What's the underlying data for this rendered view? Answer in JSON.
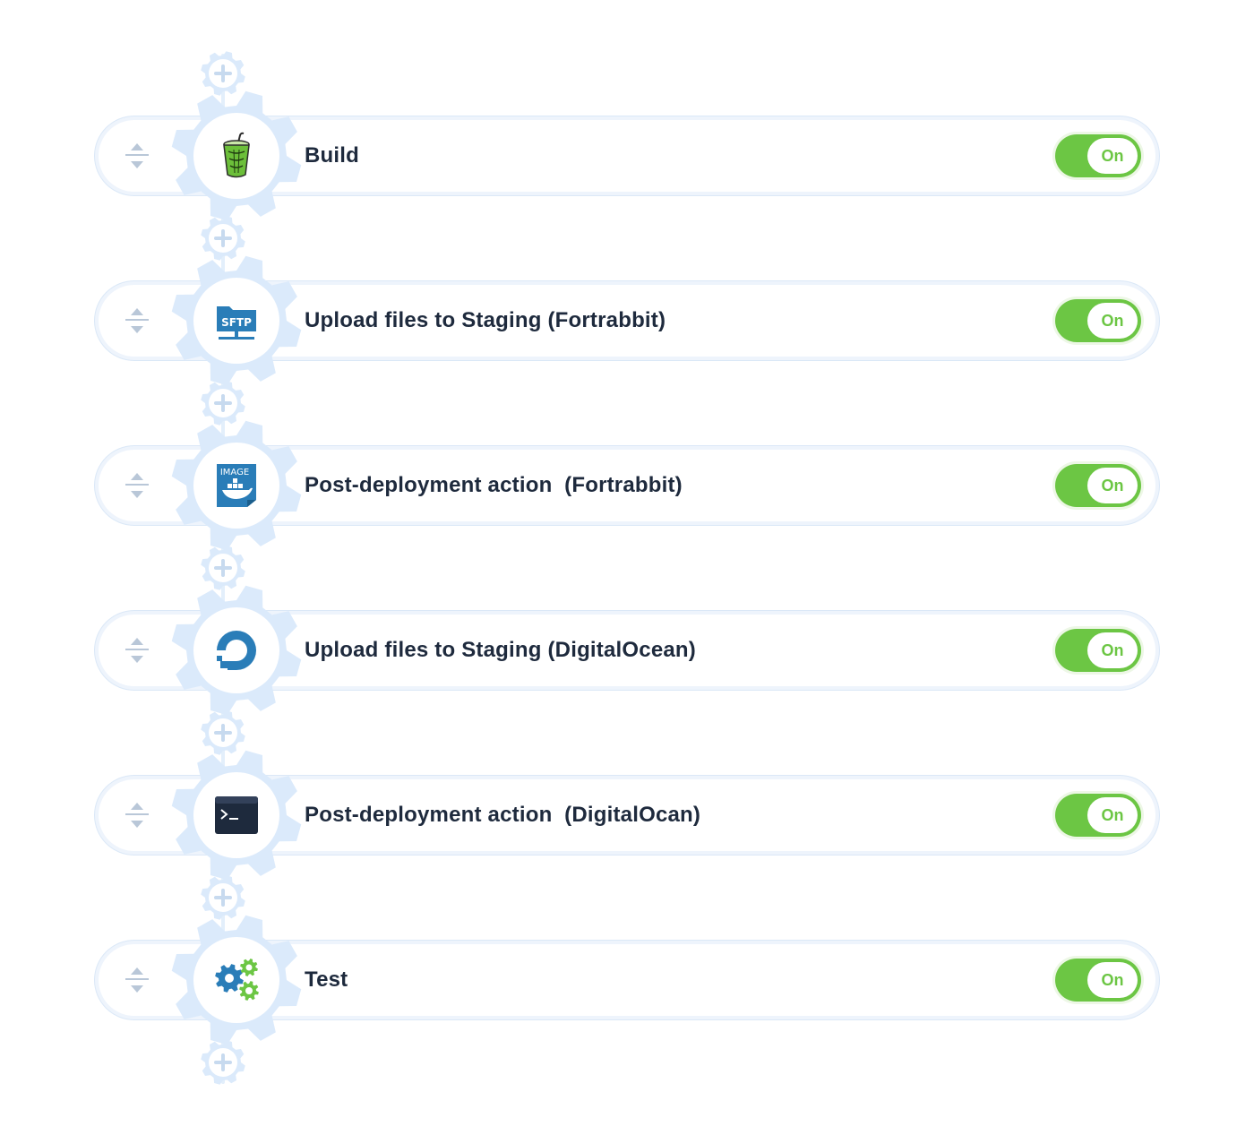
{
  "pipeline": {
    "add_action_icon": "plus-icon",
    "reorder_icon": "reorder-arrows-icon",
    "actions": [
      {
        "label": "Build",
        "icon": "gulp-cup-icon",
        "toggle": "On"
      },
      {
        "label": "Upload files to Staging (Fortrabbit)",
        "icon": "sftp-icon",
        "toggle": "On"
      },
      {
        "label": "Post-deployment action  (Fortrabbit)",
        "icon": "docker-image-icon",
        "toggle": "On"
      },
      {
        "label": "Upload files to Staging (DigitalOcean)",
        "icon": "digitalocean-icon",
        "toggle": "On"
      },
      {
        "label": "Post-deployment action  (DigitalOcan)",
        "icon": "terminal-icon",
        "toggle": "On"
      },
      {
        "label": "Test",
        "icon": "gears-icon",
        "toggle": "On"
      }
    ]
  },
  "colors": {
    "toggle_on": "#6cc644",
    "gear_light": "#dbeafb",
    "text": "#1e2a3d",
    "icon_blue": "#2a7db8"
  },
  "icon_text": {
    "sftp": "SFTP",
    "image": "IMAGE"
  }
}
